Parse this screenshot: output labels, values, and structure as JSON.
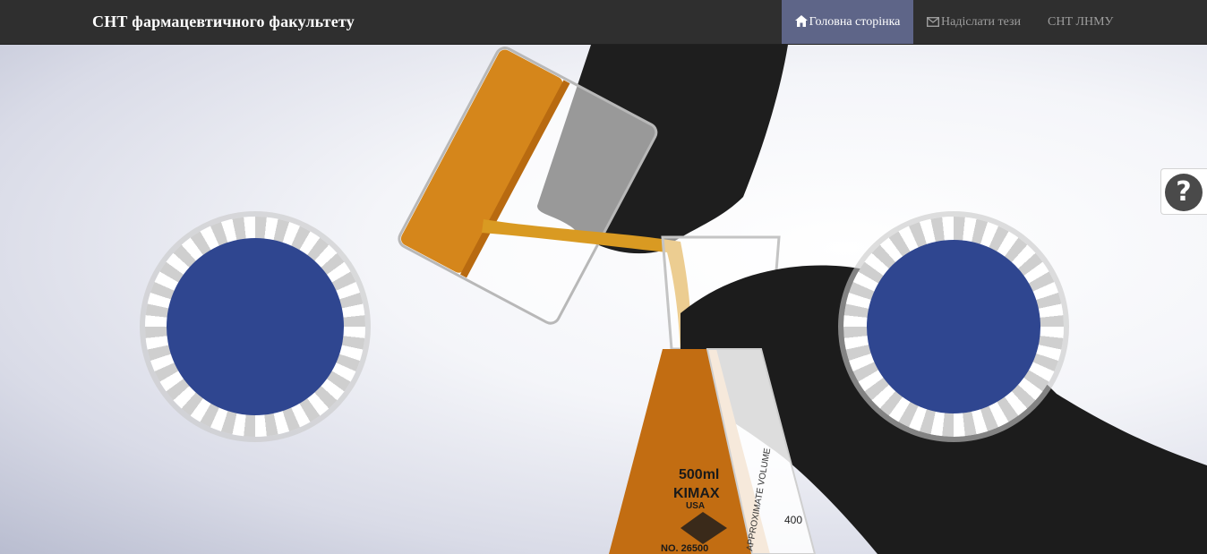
{
  "navbar": {
    "brand": "СНТ фармацевтичного факультету",
    "items": [
      {
        "label": "Головна сторінка",
        "icon": "home-icon",
        "active": true
      },
      {
        "label": "Надіслати тези",
        "icon": "envelope-icon",
        "active": false
      },
      {
        "label": "СНТ ЛНМУ",
        "icon": "",
        "active": false
      }
    ]
  },
  "hero": {
    "flask_text": [
      "500ml",
      "KIMAX",
      "USA",
      "NO. 26500",
      "APPROXIMATE VOLUME",
      "400"
    ]
  },
  "help": {
    "symbol": "?",
    "icon": "question-icon"
  },
  "colors": {
    "navbar_bg": "#2f2f2f",
    "nav_active_bg": "#5e6588",
    "nav_text": "#9d9d9d",
    "emblem_blue": "#2f4690",
    "liquid_orange": "#d5861b"
  }
}
